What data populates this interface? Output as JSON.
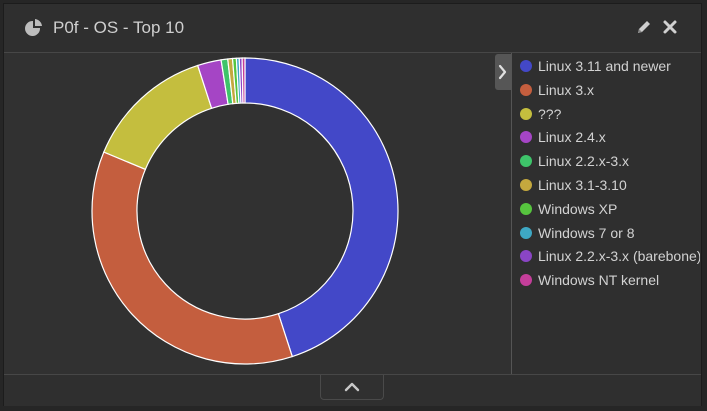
{
  "widget": {
    "title": "P0f - OS - Top 10",
    "title_icon": "pie-chart-icon",
    "edit_icon": "pencil-icon",
    "close_icon": "close-icon",
    "legend_toggle_icon": "chevron-right-icon",
    "collapse_icon": "chevron-up-icon"
  },
  "colors": {
    "background": "#262626",
    "panel": "#303030",
    "text": "#d2d2d2"
  },
  "chart_data": {
    "type": "pie",
    "donut": true,
    "title": "",
    "legend_position": "right",
    "series": [
      {
        "name": "Linux 3.11 and newer",
        "value": 45.0,
        "color": "#4348c8"
      },
      {
        "name": "Linux 3.x",
        "value": 36.3,
        "color": "#c45e3e"
      },
      {
        "name": "???",
        "value": 13.7,
        "color": "#c4be3e"
      },
      {
        "name": "Linux 2.4.x",
        "value": 2.5,
        "color": "#a545c5"
      },
      {
        "name": "Linux 2.2.x-3.x",
        "value": 0.7,
        "color": "#3ec46a"
      },
      {
        "name": "Linux 3.1-3.10",
        "value": 0.5,
        "color": "#c4a83e"
      },
      {
        "name": "Windows XP",
        "value": 0.4,
        "color": "#56c43e"
      },
      {
        "name": "Windows 7 or 8",
        "value": 0.3,
        "color": "#3ea8c4"
      },
      {
        "name": "Linux 2.2.x-3.x (barebone)",
        "value": 0.3,
        "color": "#8a45c5"
      },
      {
        "name": "Windows NT kernel",
        "value": 0.3,
        "color": "#c43e9a"
      }
    ]
  }
}
